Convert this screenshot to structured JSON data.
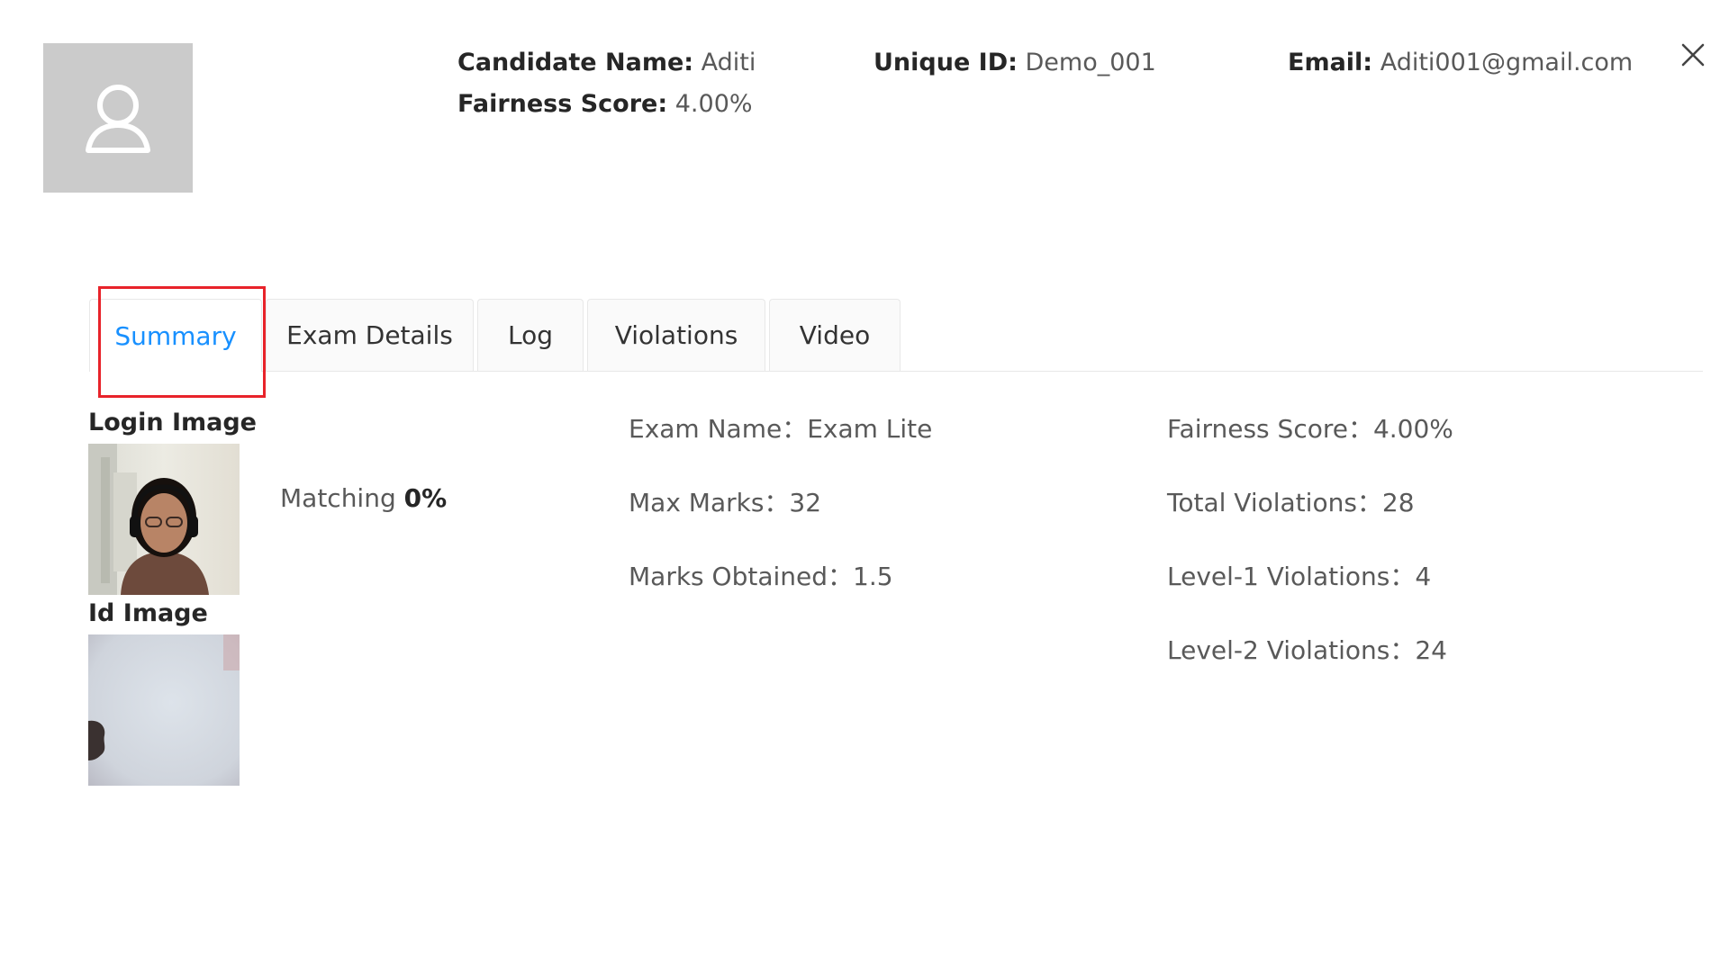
{
  "header": {
    "candidate_name_label": "Candidate Name:",
    "candidate_name_value": "Aditi",
    "unique_id_label": "Unique ID:",
    "unique_id_value": "Demo_001",
    "email_label": "Email:",
    "email_value": "Aditi001@gmail.com",
    "fairness_label": "Fairness Score:",
    "fairness_value": "4.00%",
    "avatar_icon": "user-icon",
    "close_icon": "close-icon"
  },
  "tabs": [
    {
      "label": "Summary",
      "active": true
    },
    {
      "label": "Exam Details",
      "active": false
    },
    {
      "label": "Log",
      "active": false
    },
    {
      "label": "Violations",
      "active": false
    },
    {
      "label": "Video",
      "active": false
    }
  ],
  "summary": {
    "login_image_label": "Login Image",
    "id_image_label": "Id Image",
    "matching_label": "Matching",
    "matching_value": "0%",
    "exam_name": "Exam Name：Exam Lite",
    "max_marks": "Max Marks：32",
    "marks_obtained": "Marks Obtained：1.5",
    "fairness_score": "Fairness Score：4.00%",
    "total_violations": "Total Violations：28",
    "level1_violations": "Level-1 Violations：4",
    "level2_violations": "Level-2 Violations：24"
  },
  "colors": {
    "active_tab": "#1890ff",
    "highlight": "#e8232a",
    "avatar_bg": "#cbcbcb"
  }
}
